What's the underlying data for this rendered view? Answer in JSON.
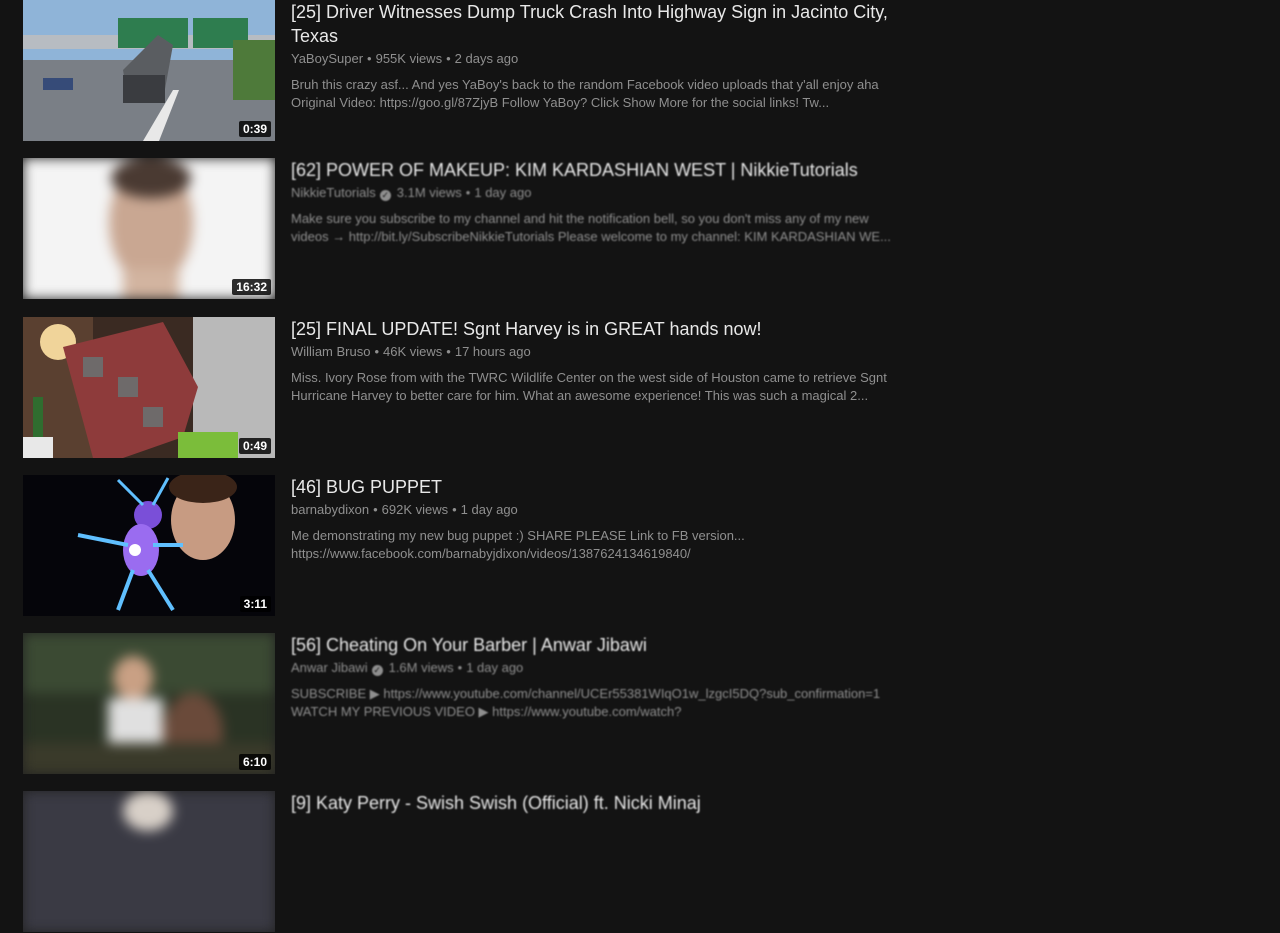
{
  "videos": [
    {
      "title": "[25] Driver Witnesses Dump Truck Crash Into Highway Sign in Jacinto City, Texas",
      "channel": "YaBoySuper",
      "verified": false,
      "views": "955K views",
      "age": "2 days ago",
      "description_line1": "Bruh this crazy asf... And yes YaBoy's back to the random Facebook video uploads that y'all enjoy aha",
      "description_line2": "Original Video: https://goo.gl/87ZjyB Follow YaBoy? Click Show More for the social links! Tw...",
      "duration": "0:39"
    },
    {
      "title": "[62] POWER OF MAKEUP: KIM KARDASHIAN WEST | NikkieTutorials",
      "channel": "NikkieTutorials",
      "verified": true,
      "views": "3.1M views",
      "age": "1 day ago",
      "description_line1": "Make sure you subscribe to my channel and hit the notification bell, so you don't miss any of my new",
      "description_line2": "videos → http://bit.ly/SubscribeNikkieTutorials Please welcome to my channel: KIM KARDASHIAN WE...",
      "duration": "16:32"
    },
    {
      "title": "[25] FINAL UPDATE! Sgnt Harvey is in GREAT hands now!",
      "channel": "William Bruso",
      "verified": false,
      "views": "46K views",
      "age": "17 hours ago",
      "description_line1": "Miss. Ivory Rose from with the TWRC Wildlife Center on the west side of Houston came to retrieve Sgnt",
      "description_line2": "Hurricane Harvey to better care for him. What an awesome experience! This was such a magical 2...",
      "duration": "0:49"
    },
    {
      "title": "[46] BUG PUPPET",
      "channel": "barnabydixon",
      "verified": false,
      "views": "692K views",
      "age": "1 day ago",
      "description_line1": "Me demonstrating my new bug puppet :) SHARE PLEASE Link to FB version...",
      "description_line2": "https://www.facebook.com/barnabyjdixon/videos/1387624134619840/",
      "duration": "3:11"
    },
    {
      "title": "[56] Cheating On Your Barber | Anwar Jibawi",
      "channel": "Anwar Jibawi",
      "verified": true,
      "views": "1.6M views",
      "age": "1 day ago",
      "description_line1": "SUBSCRIBE ▶ https://www.youtube.com/channel/UCEr55381WIqO1w_lzgcI5DQ?sub_confirmation=1",
      "description_line2": "WATCH MY PREVIOUS VIDEO ▶ https://www.youtube.com/watch?",
      "duration": "6:10"
    },
    {
      "title": "[9] Katy Perry - Swish Swish (Official) ft. Nicki Minaj",
      "channel": "",
      "verified": false,
      "views": "",
      "age": "",
      "description_line1": "",
      "description_line2": "",
      "duration": ""
    }
  ],
  "separator": "•",
  "verified_icon_glyph": "✓",
  "colors": {
    "background": "#131313",
    "title": "#e8e8e8",
    "meta": "#8f8f8f"
  }
}
